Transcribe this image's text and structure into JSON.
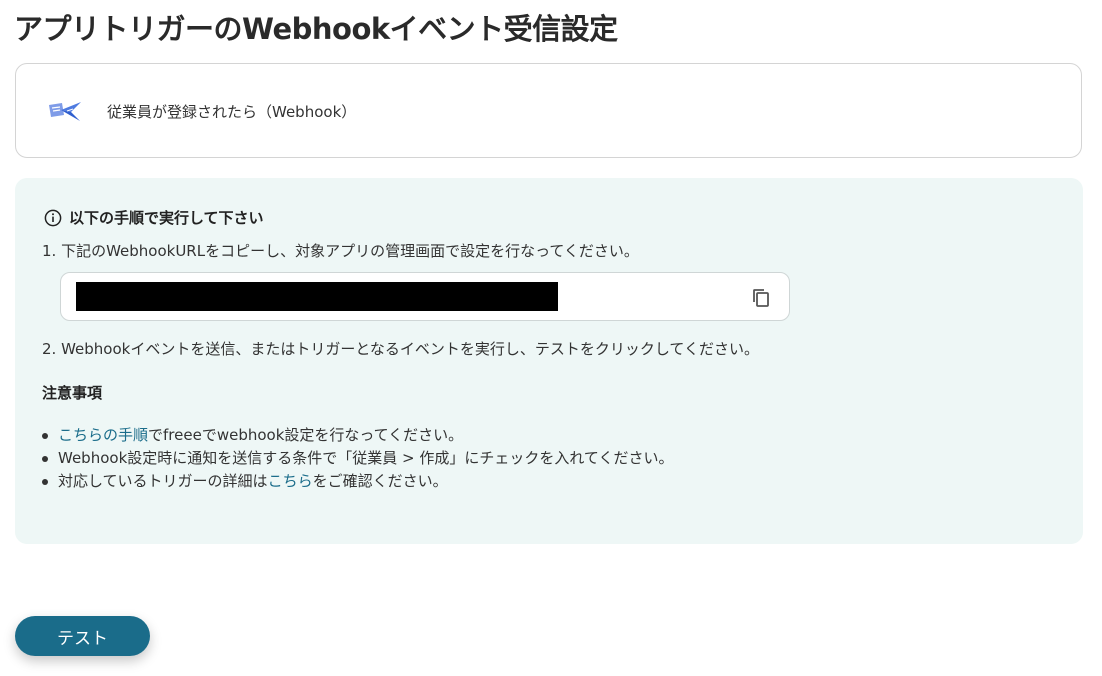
{
  "page": {
    "title": "アプリトリガーのWebhookイベント受信設定"
  },
  "trigger": {
    "icon": "freee-hr-app-icon",
    "label": "従業員が登録されたら（Webhook）"
  },
  "instructions": {
    "icon": "info-icon",
    "heading": "以下の手順で実行して下さい",
    "step1": "1. 下記のWebhookURLをコピーし、対象アプリの管理画面で設定を行なってください。",
    "url_value": "",
    "copy_icon": "copy-icon",
    "step2": "2. Webhookイベントを送信、またはトリガーとなるイベントを実行し、テストをクリックしてください。"
  },
  "notes": {
    "heading": "注意事項",
    "item1_link": "こちらの手順",
    "item1_text": "でfreeeでwebhook設定を行なってください。",
    "item2_text": "Webhook設定時に通知を送信する条件で「従業員 > 作成」にチェックを入れてください。",
    "item3_pre": "対応しているトリガーの詳細は",
    "item3_link": "こちら",
    "item3_post": "をご確認ください。"
  },
  "actions": {
    "test_label": "テスト"
  },
  "colors": {
    "accent": "#1a6c8a",
    "panel_bg": "#eef7f6",
    "border": "#d4d4d4"
  }
}
